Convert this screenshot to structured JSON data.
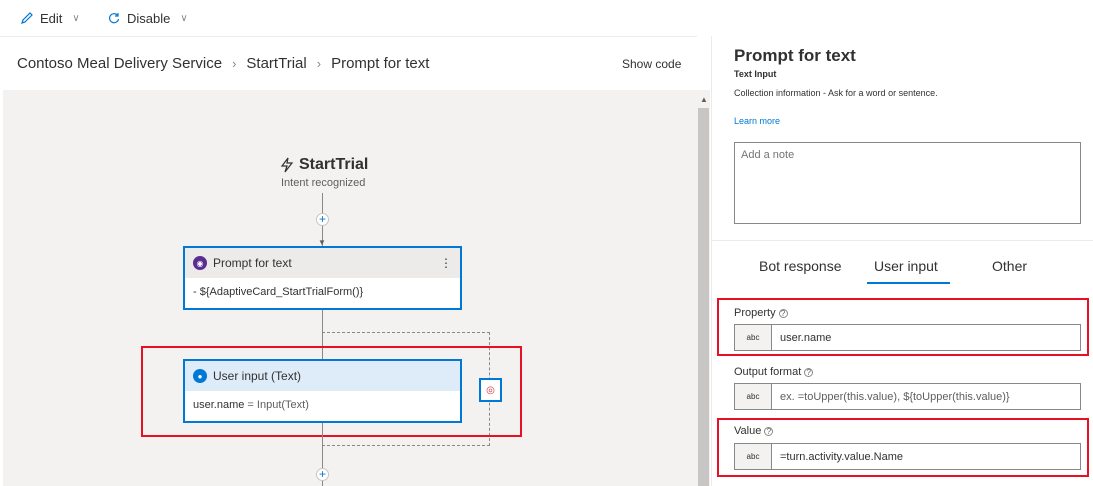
{
  "toolbar": {
    "edit_label": "Edit",
    "disable_label": "Disable"
  },
  "breadcrumb": {
    "items": [
      "Contoso Meal Delivery Service",
      "StartTrial",
      "Prompt for text"
    ],
    "show_code": "Show code"
  },
  "canvas": {
    "trigger": {
      "title": "StartTrial",
      "subtitle": "Intent recognized"
    },
    "prompt_node": {
      "title": "Prompt for text",
      "body": "- ${AdaptiveCard_StartTrialForm()}"
    },
    "input_node": {
      "title": "User input (Text)",
      "body_prop": "user.name",
      "body_eq": " = ",
      "body_val": "Input(Text)"
    }
  },
  "panel": {
    "title": "Prompt for text",
    "subtitle": "Text Input",
    "description": "Collection information - Ask for a word or sentence.",
    "learn_more": "Learn more",
    "note_placeholder": "Add a note",
    "tabs": [
      {
        "label": "Bot response"
      },
      {
        "label": "User input",
        "active": true
      },
      {
        "label": "Other"
      }
    ],
    "fields": {
      "property": {
        "label": "Property",
        "prefix": "abc",
        "value": "user.name"
      },
      "output_format": {
        "label": "Output format",
        "prefix": "abc",
        "placeholder": "ex. =toUpper(this.value), ${toUpper(this.value)}"
      },
      "value": {
        "label": "Value",
        "prefix": "abc",
        "value": "=turn.activity.value.Name"
      }
    }
  },
  "colors": {
    "accent": "#0078d4",
    "highlight": "#e81123",
    "prompt_icon": "#5c2d91",
    "input_icon": "#0078d4"
  }
}
